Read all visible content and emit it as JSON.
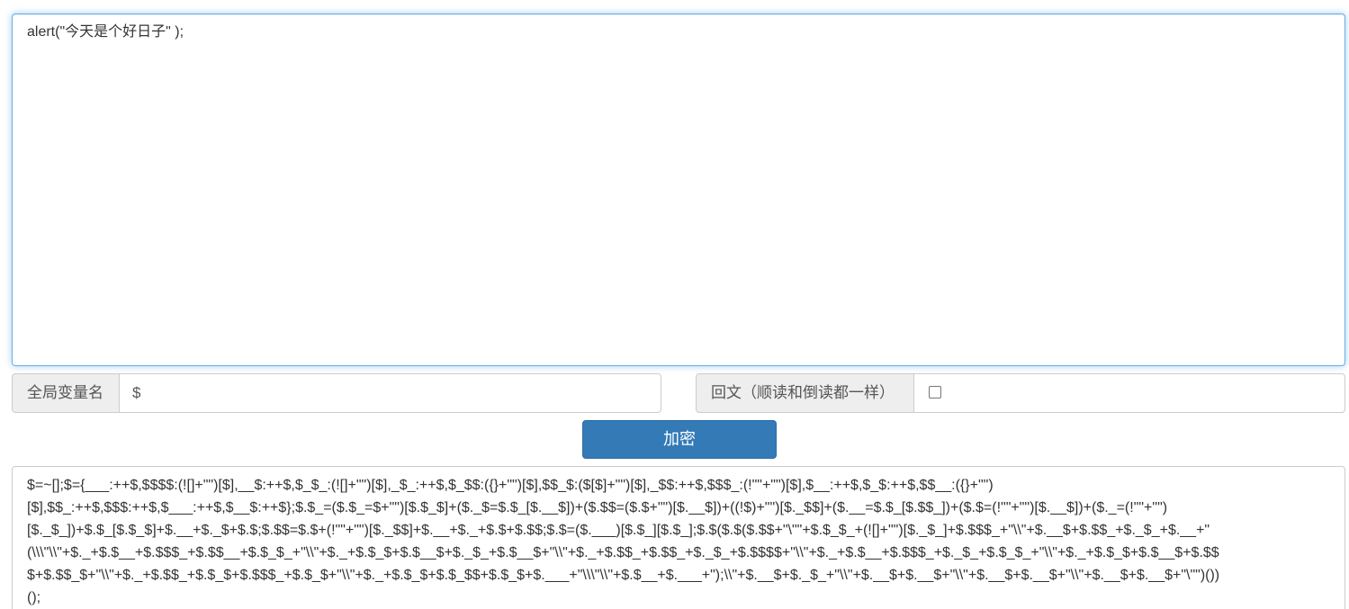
{
  "source": {
    "value": "alert(\"今天是个好日子\" );"
  },
  "global_var": {
    "label": "全局变量名",
    "value": "$"
  },
  "palindrome": {
    "label": "回文（顺读和倒读都一样）",
    "checked": false
  },
  "encrypt_button": {
    "label": "加密"
  },
  "output": {
    "lines": [
      "$=~[];$={___:++$,$$$$:(![]+\"\")[$],__$:++$,$_$_:(![]+\"\")[$],_$_:++$,$_$$:({}+\"\")[$],$$_$:($[$]+\"\")[$],_$$:++$,$$$_:(!\"\"+\"\")[$],$__:++$,$_$:++$,$$__:({}+\"\")",
      "[$],$$_:++$,$$$:++$,$___:++$,$__$:++$};$.$_=($.$_=$+\"\")[$.$_$]+($._$=$.$_[$.__$])+($.$$=($.$+\"\")[$.__$])+((!$)+\"\")[$._$$]+($.__=$.$_[$.$$_])+($.$=(!\"\"+\"\")[$.__$])+($._=(!\"\"+\"\")",
      "[$._$_])+$.$_[$.$_$]+$.__+$._$+$.$;$.$$=$.$+(!\"\"+\"\")[$._$$]+$.__+$._+$.$+$.$$;$.$=($.___)[$.$_][$.$_];$.$($.$($.$$+\"\\\"\"+$.$_$_+(![]+\"\")[$._$_]+$.$$$_+\"\\\\\"+$.__$+$.$$_+$._$_+$.__+\"",
      "(\\\\\\\"\\\\\"+$._+$.$__+$.$$$_+$.$$__+$.$_$_+\"\\\\\"+$._+$.$_$+$.$__$+$._$_+$.$__$+\"\\\\\"+$._+$.$$_+$.$$_+$._$_+$.$$$$+\"\\\\\"+$._+$.$__+$.$$$_+$._$_+$.$_$_+\"\\\\\"+$._+$.$_$+$.$__$+$.$$",
      "$+$.$$_$+\"\\\\\"+$._+$.$$_+$.$_$+$.$$$_+$.$_$+\"\\\\\"+$._+$.$_$+$.$_$$+$.$_$+$.___+\"\\\\\\\"\\\\\"+$.$__+$.___+\");\\\\\"+$.__$+$._$_+\"\\\\\"+$.__$+$.__$+\"\\\\\"+$.__$+$.__$+\"\\\\\"+$.__$+$.__$+\"\\\"\")())",
      "();"
    ]
  }
}
